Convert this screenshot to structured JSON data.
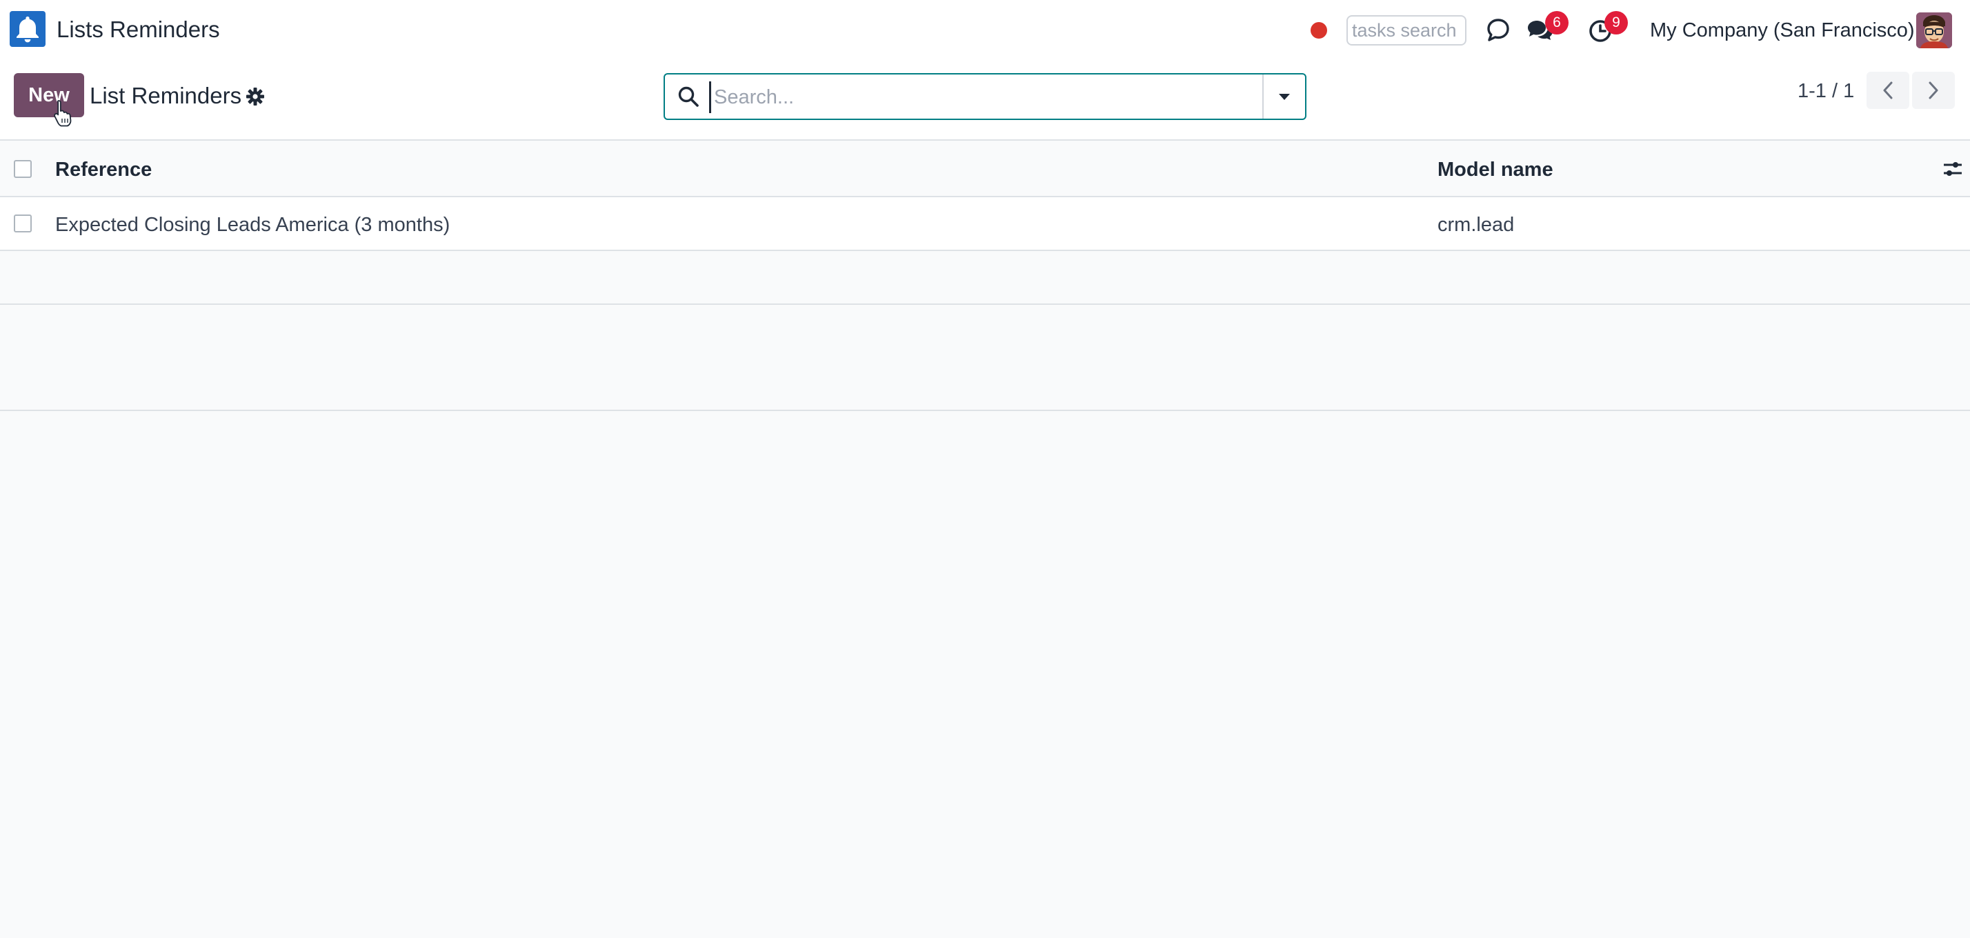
{
  "navbar": {
    "app_title": "Lists Reminders",
    "tasks_search_placeholder": "tasks search",
    "messages_count": "6",
    "activities_count": "9",
    "company": "My Company (San Francisco)"
  },
  "control_panel": {
    "new_label": "New",
    "breadcrumb": "List Reminders",
    "search_placeholder": "Search...",
    "pager_value": "1-1 / 1"
  },
  "list": {
    "columns": [
      "Reference",
      "Model name"
    ],
    "rows": [
      {
        "reference": "Expected Closing Leads America (3 months)",
        "model_name": "crm.lead"
      }
    ]
  },
  "colors": {
    "brand": "#714b67",
    "accent_focus": "#017e84",
    "badge": "#e11d3a",
    "record_dot": "#d9342b",
    "logo": "#1f6cc4"
  },
  "icons": [
    "bell-icon",
    "settings-gear-icon",
    "search-icon",
    "caret-down-icon",
    "chevron-left-icon",
    "chevron-right-icon",
    "optional-columns-icon",
    "discuss-chat-icon",
    "messages-icon",
    "activities-clock-icon",
    "pointer-cursor-icon"
  ]
}
